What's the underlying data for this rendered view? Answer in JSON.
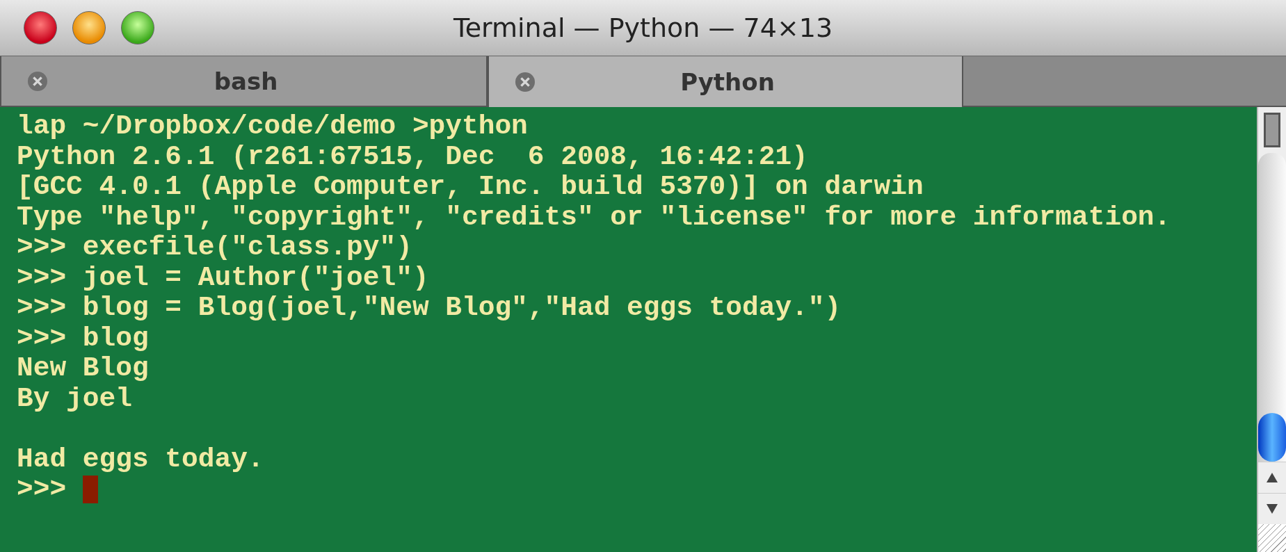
{
  "window": {
    "title": "Terminal — Python — 74×13"
  },
  "tabs": [
    {
      "label": "bash",
      "selected": false
    },
    {
      "label": "Python",
      "selected": true
    }
  ],
  "terminal": {
    "lines": [
      {
        "kind": "text",
        "text": "lap ~/Dropbox/code/demo >python"
      },
      {
        "kind": "text",
        "text": "Python 2.6.1 (r261:67515, Dec  6 2008, 16:42:21)"
      },
      {
        "kind": "text",
        "text": "[GCC 4.0.1 (Apple Computer, Inc. build 5370)] on darwin"
      },
      {
        "kind": "text",
        "text": "Type \"help\", \"copyright\", \"credits\" or \"license\" for more information."
      },
      {
        "kind": "text",
        "text": ">>> execfile(\"class.py\")"
      },
      {
        "kind": "text",
        "text": ">>> joel = Author(\"joel\")"
      },
      {
        "kind": "text",
        "text": ">>> blog = Blog(joel,\"New Blog\",\"Had eggs today.\")"
      },
      {
        "kind": "text",
        "text": ">>> blog"
      },
      {
        "kind": "text",
        "text": "New Blog"
      },
      {
        "kind": "text",
        "text": "By joel"
      },
      {
        "kind": "blank"
      },
      {
        "kind": "text",
        "text": "Had eggs today."
      }
    ],
    "prompt": ">>> "
  }
}
